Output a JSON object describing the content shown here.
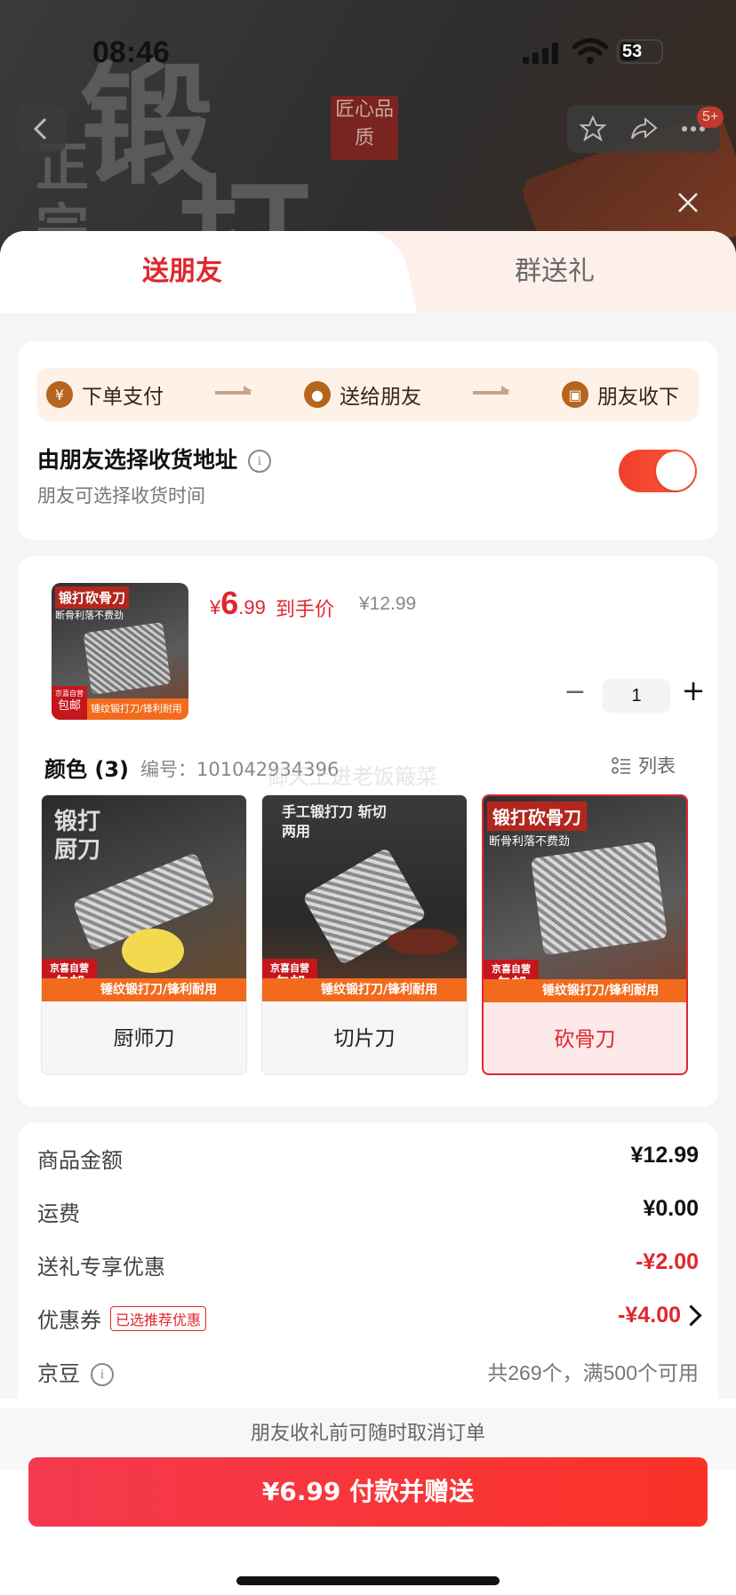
{
  "status_bar": {
    "time": "08:46",
    "battery": "53"
  },
  "nav": {
    "badge": "5+"
  },
  "hero": {
    "chars": [
      "锻",
      "打",
      "正",
      "宗"
    ],
    "seal": "匠心品质"
  },
  "tabs": {
    "active": "送朋友",
    "inactive": "群送礼"
  },
  "steps": [
    {
      "icon": "yen-icon",
      "label": "下单支付"
    },
    {
      "icon": "wechat-icon",
      "label": "送给朋友"
    },
    {
      "icon": "gift-icon",
      "label": "朋友收下"
    }
  ],
  "address": {
    "title": "由朋友选择收货地址",
    "subtitle": "朋友可选择收货时间",
    "toggle_on": true
  },
  "product": {
    "image": {
      "tag": "锻打砍骨刀",
      "sub": "断骨利落不费劲",
      "mail_top": "京喜自营",
      "mail": "包邮",
      "band": "锤纹锻打刀/锋利耐用"
    },
    "price_symbol": "¥",
    "price_int": "6",
    "price_dec": ".99",
    "price_label": "到手价",
    "original_price": "¥12.99",
    "quantity": "1",
    "minus": "−",
    "plus": "+"
  },
  "variant": {
    "label": "颜色 (3)",
    "sku": "编号：101042934396",
    "watermark": "御天上进老饭簸菜",
    "list_label": "列表",
    "options": [
      {
        "label": "厨师刀",
        "caption": "锻打厨刀",
        "band": "锤纹锻打刀/锋利耐用",
        "mail_top": "京喜自营",
        "mail": "包邮",
        "selected": false
      },
      {
        "label": "切片刀",
        "caption": "手工锻打刀 斩切两用",
        "band": "锤纹锻打刀/锋利耐用",
        "mail_top": "京喜自营",
        "mail": "包邮",
        "selected": false
      },
      {
        "label": "砍骨刀",
        "caption": "锻打砍骨刀",
        "caption2": "断骨利落不费劲",
        "band": "锤纹锻打刀/锋利耐用",
        "mail_top": "京喜自营",
        "mail": "包邮",
        "selected": true
      }
    ]
  },
  "fees": [
    {
      "key": "商品金额",
      "value": "¥12.99",
      "red": false
    },
    {
      "key": "运费",
      "value": "¥0.00",
      "red": false
    },
    {
      "key": "送礼专享优惠",
      "value": "-¥2.00",
      "red": true
    },
    {
      "key": "优惠券",
      "tag": "已选推荐优惠",
      "value": "-¥4.00",
      "red": true,
      "chevron": true
    },
    {
      "key": "京豆",
      "value": "共269个，满500个可用",
      "red": false,
      "info": true
    }
  ],
  "footer": {
    "note": "朋友收礼前可随时取消订单",
    "pay_button": "¥6.99 付款并赠送"
  },
  "colors": {
    "accent": "#e0272d",
    "orange": "#f26b1d",
    "step_bg": "#fdf1e8",
    "step_icon": "#b5651d"
  }
}
